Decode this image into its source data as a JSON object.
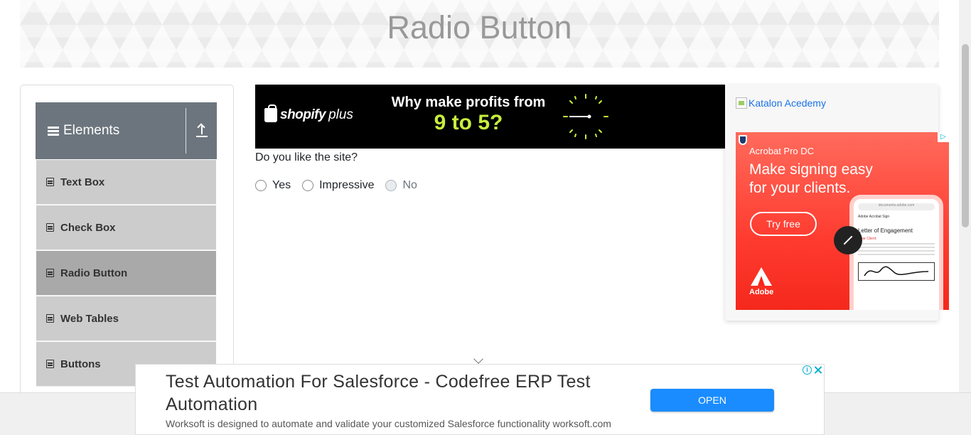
{
  "header": {
    "title": "Radio Button"
  },
  "sidebar": {
    "group_title": "Elements",
    "items": [
      {
        "label": "Text Box"
      },
      {
        "label": "Check Box"
      },
      {
        "label": "Radio Button"
      },
      {
        "label": "Web Tables"
      },
      {
        "label": "Buttons"
      }
    ]
  },
  "shopify_ad": {
    "brand": "shopify",
    "brand_suffix": "plus",
    "line1": "Why make profits from",
    "line2": "9 to 5?"
  },
  "main": {
    "question": "Do you like the site?",
    "options": [
      {
        "label": "Yes",
        "disabled": false
      },
      {
        "label": "Impressive",
        "disabled": false
      },
      {
        "label": "No",
        "disabled": true
      }
    ]
  },
  "right_ads": {
    "katalon_alt": "Katalon Acedemy",
    "adobe": {
      "product": "Acrobat Pro DC",
      "tagline": "Make signing easy for your clients.",
      "cta": "Try free",
      "brand": "Adobe",
      "doc_title": "Letter of Engagement",
      "doc_greeting": "Dear Client:",
      "app_name": "Adobe Acrobat Sign",
      "url": "documents.adobe.com"
    }
  },
  "bottom_ad": {
    "headline": "Test Automation For Salesforce - Codefree ERP Test Automation",
    "description": "Worksoft is designed to automate and validate your customized Salesforce functionality worksoft.com",
    "cta": "OPEN"
  },
  "colors": {
    "sidebar_header": "#6c757d",
    "menu_item": "#cccccc",
    "menu_item_active": "#a9a9a9",
    "shopify_accent": "#c7ee3e",
    "adobe_red": "#ff3b30",
    "open_button": "#1a8cff"
  }
}
